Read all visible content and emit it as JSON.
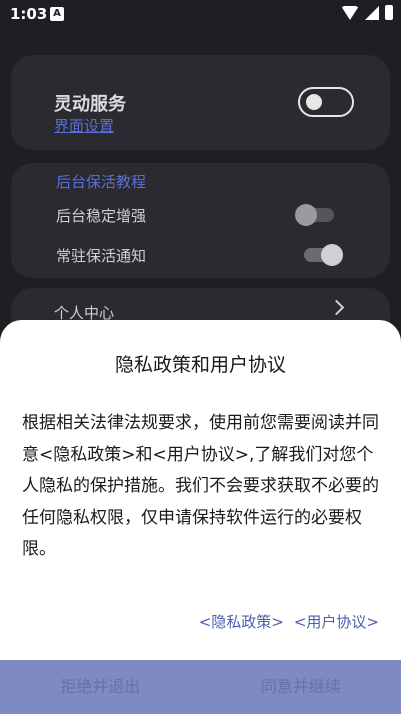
{
  "status_bar": {
    "time": "1:03",
    "notification_glyph": "A"
  },
  "service_card": {
    "title": "灵动服务",
    "subtitle_link": "界面设置"
  },
  "keepalive_card": {
    "section_title": "后台保活教程",
    "rows": [
      {
        "label": "后台稳定增强"
      },
      {
        "label": "常驻保活通知"
      }
    ]
  },
  "personal_card": {
    "label": "个人中心"
  },
  "dialog": {
    "title": "隐私政策和用户协议",
    "body": "根据相关法律法规要求，使用前您需要阅读并同意<隐私政策>和<用户协议>,了解我们对您个人隐私的保护措施。我们不会要求获取不必要的任何隐私权限，仅申请保持软件运行的必要权限。",
    "privacy_link": "<隐私政策>",
    "agreement_link": "<用户协议>",
    "reject_button": "拒绝并退出",
    "accept_button": "同意并继续"
  },
  "colors": {
    "accent": "#5b6fd6",
    "button_bar": "#7e8ac4"
  }
}
